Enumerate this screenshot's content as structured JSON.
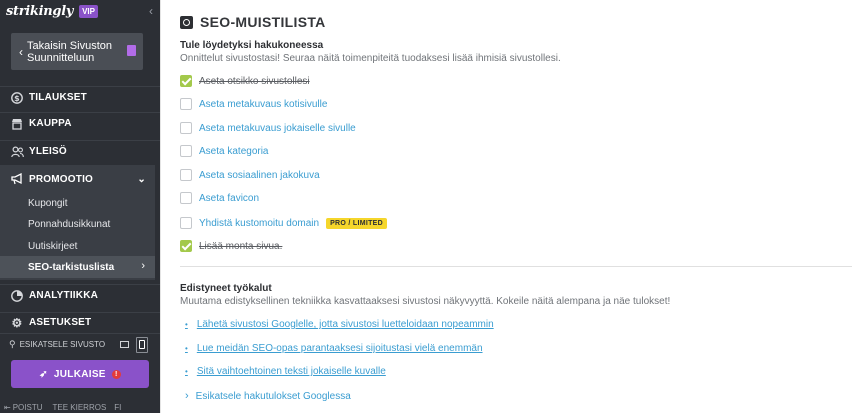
{
  "sidebar": {
    "logo": "strikingly",
    "vip_badge": "VIP",
    "back_label": "Takaisin Sivuston Suunnitteluun",
    "nav": {
      "orders": "TILAUKSET",
      "store": "KAUPPA",
      "audience": "YLEISÖ",
      "promotion": "PROMOOTIO",
      "analytics": "ANALYTIIKKA",
      "settings": "ASETUKSET"
    },
    "promotion_sub": [
      "Kupongit",
      "Ponnahdusikkunat",
      "Uutiskirjeet",
      "SEO-tarkistuslista"
    ],
    "preview_label": "ESIKATSELE SIVUSTO",
    "publish_label": "JULKAISE",
    "publish_alert": "!",
    "footer": [
      "POISTU",
      "TEE KIERROS",
      "FI"
    ]
  },
  "main": {
    "title": "SEO-MUISTILISTA",
    "found_title": "Tule löydetyksi hakukoneessa",
    "found_sub": "Onnittelut sivustostasi! Seuraa näitä toimenpiteitä tuodaksesi lisää ihmisiä sivustollesi.",
    "checklist": [
      {
        "label": "Aseta otsikko sivustollesi",
        "done": true
      },
      {
        "label": "Aseta metakuvaus kotisivulle",
        "done": false
      },
      {
        "label": "Aseta metakuvaus jokaiselle sivulle",
        "done": false
      },
      {
        "label": "Aseta kategoria",
        "done": false
      },
      {
        "label": "Aseta sosiaalinen jakokuva",
        "done": false
      },
      {
        "label": "Aseta favicon",
        "done": false
      },
      {
        "label": "Yhdistä kustomoitu domain",
        "done": false,
        "badge": "PRO / LIMITED"
      },
      {
        "label": "Lisää monta sivua.",
        "done": true
      }
    ],
    "advanced_title": "Edistyneet työkalut",
    "advanced_sub": "Muutama edistyksellinen tekniikka kasvattaaksesi sivustosi näkyvyyttä. Kokeile näitä alempana ja näe tulokset!",
    "tools": [
      "Lähetä sivustosi Googlelle, jotta sivustosi luetteloidaan nopeammin",
      "Lue meidän SEO-opas parantaaksesi sijoitustasi vielä enemmän",
      "Sitä vaihtoehtoinen teksti jokaiselle kuvalle"
    ],
    "google_preview": "Esikatsele hakutulokset Googlessa"
  },
  "colors": {
    "sidebar_bg": "#2c2f35",
    "accent_purple": "#8a52c9",
    "link_blue": "#3a9dd1",
    "check_green": "#a3c94b",
    "pro_yellow": "#f5d62b"
  }
}
